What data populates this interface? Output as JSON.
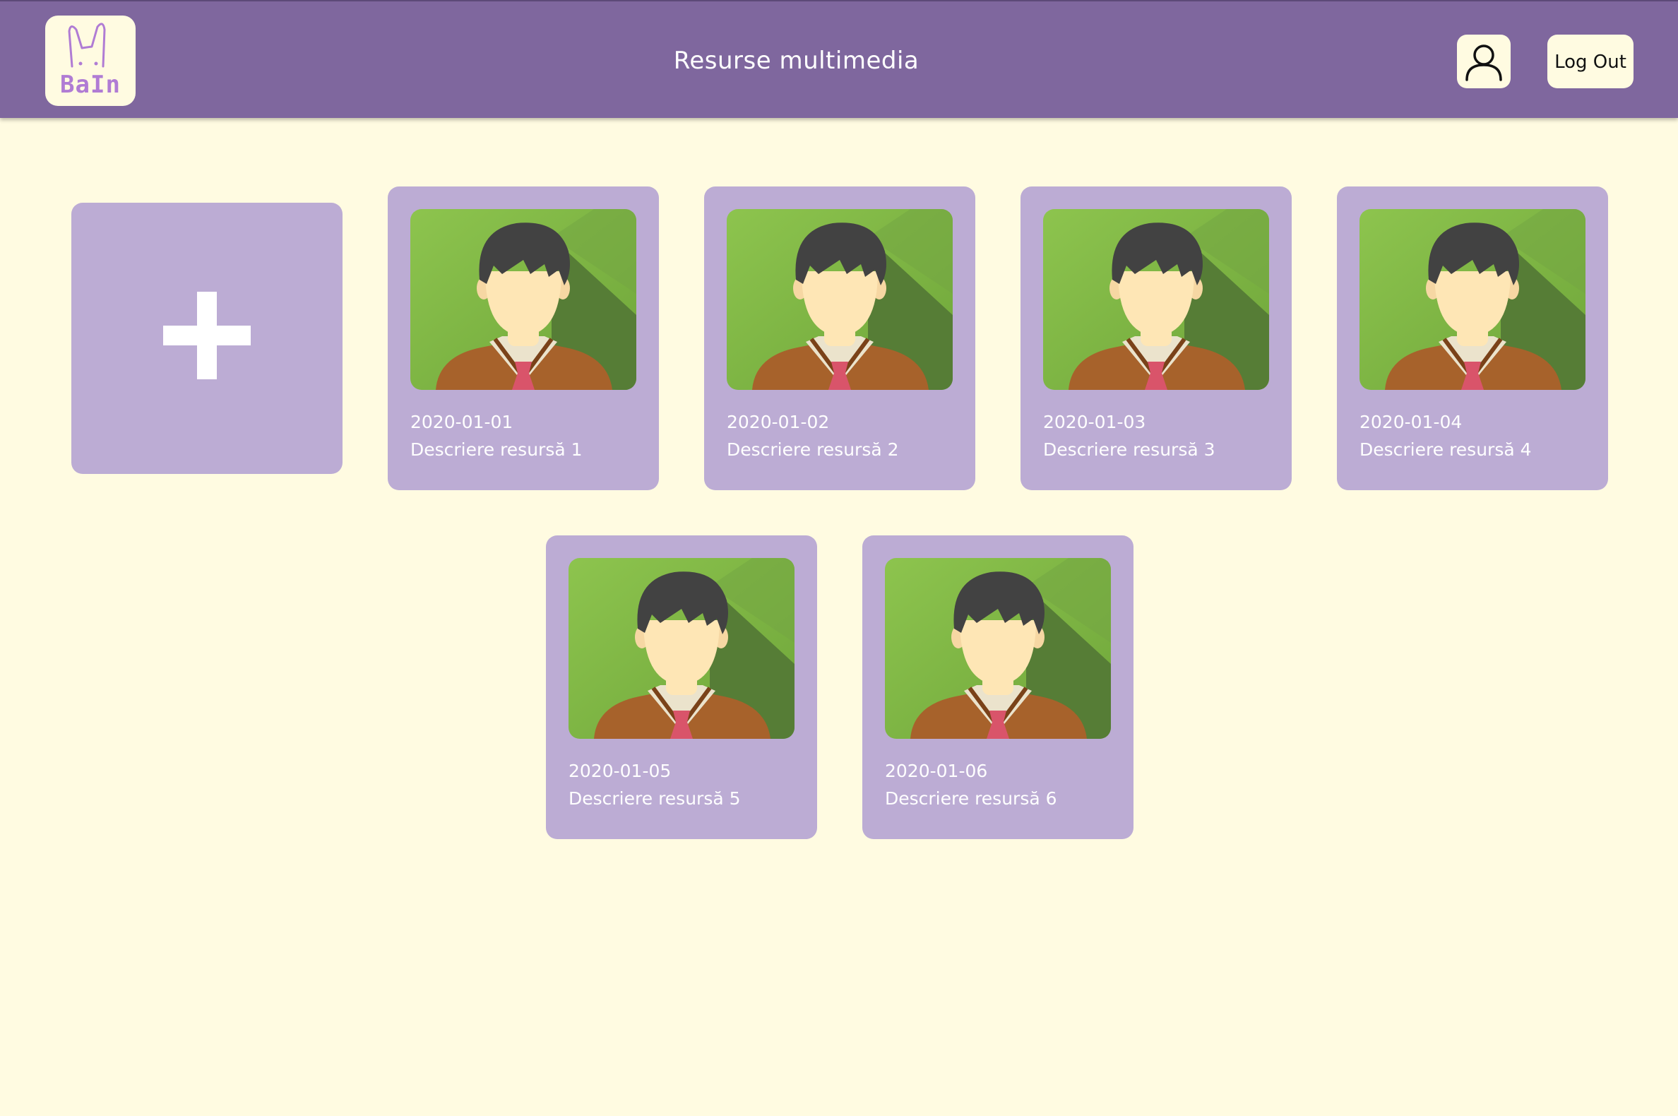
{
  "header": {
    "logo_text": "BaIn",
    "title": "Resurse multimedia",
    "profile_icon": "user-icon",
    "logout_label": "Log Out"
  },
  "colors": {
    "header_bg": "#7f679e",
    "page_bg": "#fffbe1",
    "card_bg": "#bcacd4",
    "logo_accent": "#b07cd4"
  },
  "add_tile": {
    "icon": "plus-icon"
  },
  "resources": [
    {
      "date": "2020-01-01",
      "description": "Descriere resursă 1",
      "thumbnail_icon": "avatar-thumbnail"
    },
    {
      "date": "2020-01-02",
      "description": "Descriere resursă 2",
      "thumbnail_icon": "avatar-thumbnail"
    },
    {
      "date": "2020-01-03",
      "description": "Descriere resursă 3",
      "thumbnail_icon": "avatar-thumbnail"
    },
    {
      "date": "2020-01-04",
      "description": "Descriere resursă 4",
      "thumbnail_icon": "avatar-thumbnail"
    },
    {
      "date": "2020-01-05",
      "description": "Descriere resursă 5",
      "thumbnail_icon": "avatar-thumbnail"
    },
    {
      "date": "2020-01-06",
      "description": "Descriere resursă 6",
      "thumbnail_icon": "avatar-thumbnail"
    }
  ]
}
